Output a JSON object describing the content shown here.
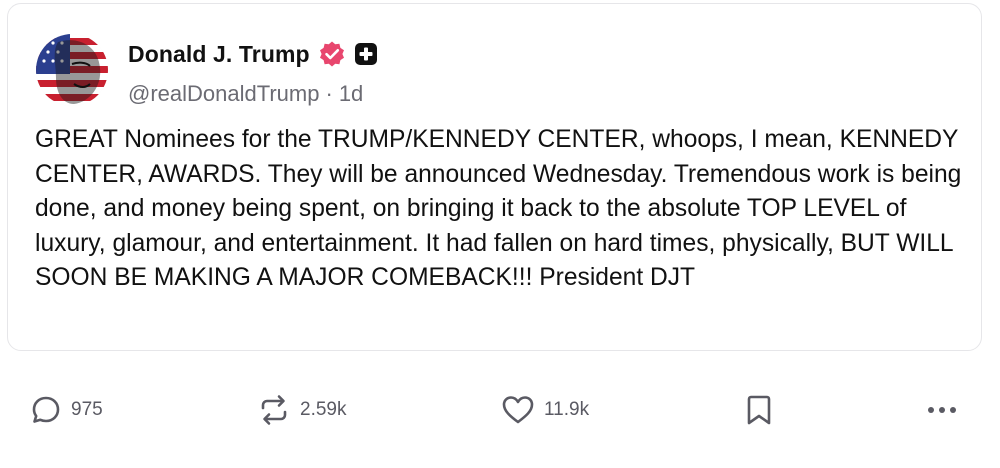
{
  "post": {
    "author": {
      "display_name": "Donald J. Trump",
      "handle": "@realDonaldTrump",
      "separator": "·",
      "timestamp": "1d",
      "avatar_icon": "flag-face-avatar",
      "verified_icon": "verified-badge-icon",
      "plus_icon": "plus-badge-icon"
    },
    "text": "GREAT Nominees for the TRUMP/KENNEDY CENTER, whoops, I mean, KENNEDY CENTER, AWARDS. They will be announced Wednesday. Tremendous work is being done, and money being spent, on bringing it back to the absolute TOP LEVEL of luxury, glamour, and entertainment. It had fallen on hard times, physically, BUT WILL SOON BE MAKING A MAJOR COMEBACK!!! President DJT"
  },
  "actions": {
    "reply": {
      "icon": "reply-icon",
      "count": "975"
    },
    "repost": {
      "icon": "repost-icon",
      "count": "2.59k"
    },
    "like": {
      "icon": "heart-icon",
      "count": "11.9k"
    },
    "bookmark": {
      "icon": "bookmark-icon"
    },
    "more": {
      "icon": "more-icon"
    }
  },
  "colors": {
    "verified_badge": "#e8466e",
    "text_primary": "#111111",
    "text_secondary": "#6b6b73",
    "card_border": "#e6e6e9"
  }
}
